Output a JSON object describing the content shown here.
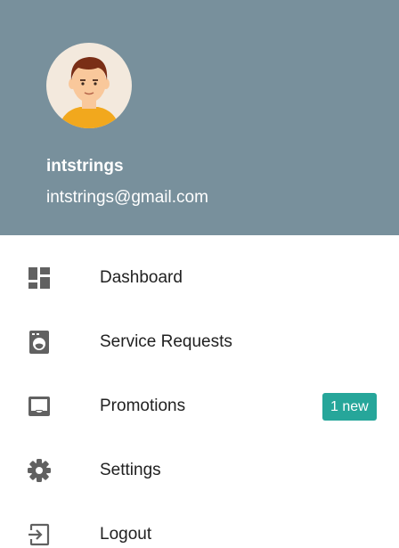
{
  "colors": {
    "header_background": "#78909c",
    "icon": "#616161",
    "badge": "#26a69a",
    "avatar_background": "#f3e9dd",
    "shirt": "#f2a81d",
    "hair": "#7a2e16",
    "skin": "#f9c89b"
  },
  "header": {
    "avatar": "male-user-avatar",
    "name": "intstrings",
    "email": "intstrings@gmail.com"
  },
  "menu": {
    "items": [
      {
        "icon": "dashboard-icon",
        "label": "Dashboard"
      },
      {
        "icon": "washing-machine-icon",
        "label": "Service Requests"
      },
      {
        "icon": "inbox-icon",
        "label": "Promotions",
        "badge": "1 new"
      },
      {
        "icon": "gear-icon",
        "label": "Settings"
      },
      {
        "icon": "logout-icon",
        "label": "Logout"
      }
    ]
  }
}
